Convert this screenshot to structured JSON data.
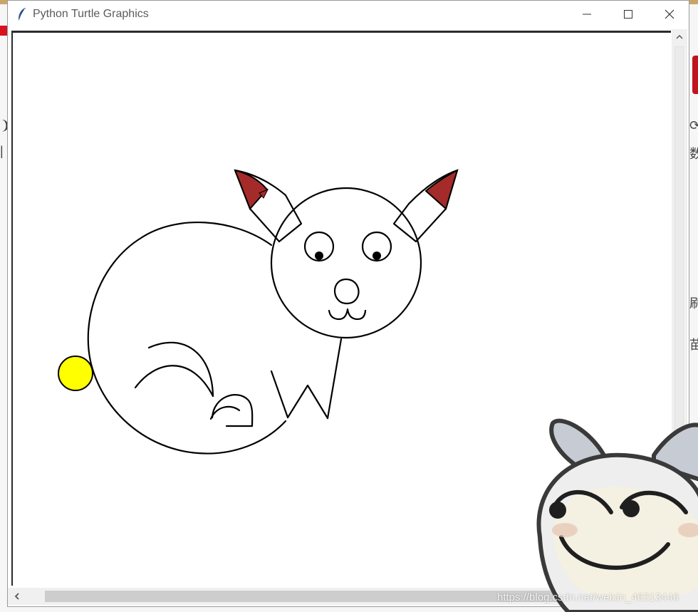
{
  "window": {
    "title": "Python Turtle Graphics",
    "controls": {
      "minimize": "minimize",
      "maximize": "maximize",
      "close": "close"
    }
  },
  "canvas": {
    "background": "#ffffff",
    "drawing": {
      "outline_color": "#000000",
      "ear_tip_color": "#a52a2a",
      "tail_color": "#ffff00"
    }
  },
  "watermark": {
    "text": "https://blog.csdn.net/weixin_46313446"
  },
  "background_fragments": {
    "left_glyph_1": "❩",
    "left_glyph_2": "|",
    "right_glyph_1": "⟳",
    "right_glyph_2": "数",
    "right_glyph_3": "刷",
    "right_glyph_4": "苗"
  },
  "colors": {
    "title_text": "#5b5b5b",
    "scrollbar_track": "#f0f0f0",
    "scrollbar_thumb": "#cdcdcd",
    "sticker_body": "#eeeeee",
    "sticker_outline": "#3a3a3a"
  }
}
